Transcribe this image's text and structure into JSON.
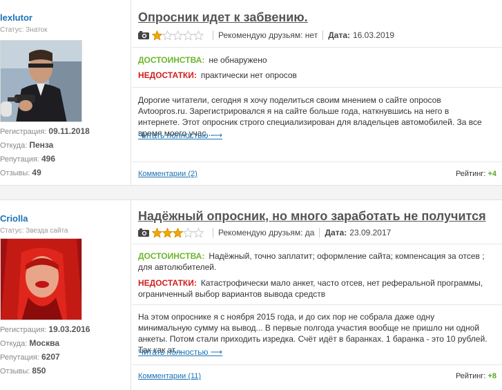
{
  "reviews": [
    {
      "username": "lexlutor",
      "status": "Статус: Знаток",
      "reg_label": "Регистрация:",
      "reg_value": "09.11.2018",
      "from_label": "Откуда:",
      "from_value": "Пенза",
      "rep_label": "Репутация:",
      "rep_value": "496",
      "reviews_label": "Отзывы:",
      "reviews_value": "49",
      "title": "Опросник идет к забвению.",
      "stars": 1,
      "stars_max": 5,
      "recommend": "Рекомендую друзьям: нет",
      "date_label": "Дата:",
      "date_value": "16.03.2019",
      "pros_label": "ДОСТОИНСТВА:",
      "pros": "не обнаружено",
      "cons_label": "НЕДОСТАТКИ:",
      "cons": "практически нет опросов",
      "text": "Дорогие читатели, сегодня я хочу поделиться своим мнением о сайте опросов Avtoopros.ru. Зарегистрировался я на сайте больше года, наткнувшись на него в интернете. Этот опросник строго специализирован для владельцев автомобилей. За все время моего учас...",
      "read_more": "Читать полностью ⟶",
      "comments": "Комментарии (2)",
      "rating_label": "Рейтинг:",
      "rating_value": "+4"
    },
    {
      "username": "Criolla",
      "status": "Статус: Звезда сайта",
      "reg_label": "Регистрация:",
      "reg_value": "19.03.2016",
      "from_label": "Откуда:",
      "from_value": "Москва",
      "rep_label": "Репутация:",
      "rep_value": "6207",
      "reviews_label": "Отзывы:",
      "reviews_value": "850",
      "title": "Надёжный опросник, но много заработать не получится",
      "stars": 3,
      "stars_max": 5,
      "recommend": "Рекомендую друзьям: да",
      "date_label": "Дата:",
      "date_value": "23.09.2017",
      "pros_label": "ДОСТОИНСТВА:",
      "pros": "Надёжный, точно заплатит; оформление сайта; компенсация за отсев ; для автолюбителей.",
      "cons_label": "НЕДОСТАТКИ:",
      "cons": "Катастрофически мало анкет, часто отсев, нет реферальной программы, ограниченный выбор вариантов вывода средств",
      "text": "На этом опроснике я с ноября 2015 года, и до сих пор не собрала даже одну минимальную сумму на вывод... В первые полгода участия вообще не пришло ни одной анкеты. Потом стали приходить изредка. Счёт идёт в баранках. 1 баранка - это 10 рублей. Так как эт...",
      "read_more": "Читать полностью ⟶",
      "comments": "Комментарии (11)",
      "rating_label": "Рейтинг:",
      "rating_value": "+8"
    }
  ],
  "colors": {
    "link": "#1a73b5",
    "pros": "#6cb52a",
    "cons": "#d11e1e",
    "star_filled": "#f2a900",
    "star_empty": "#cccccc"
  }
}
